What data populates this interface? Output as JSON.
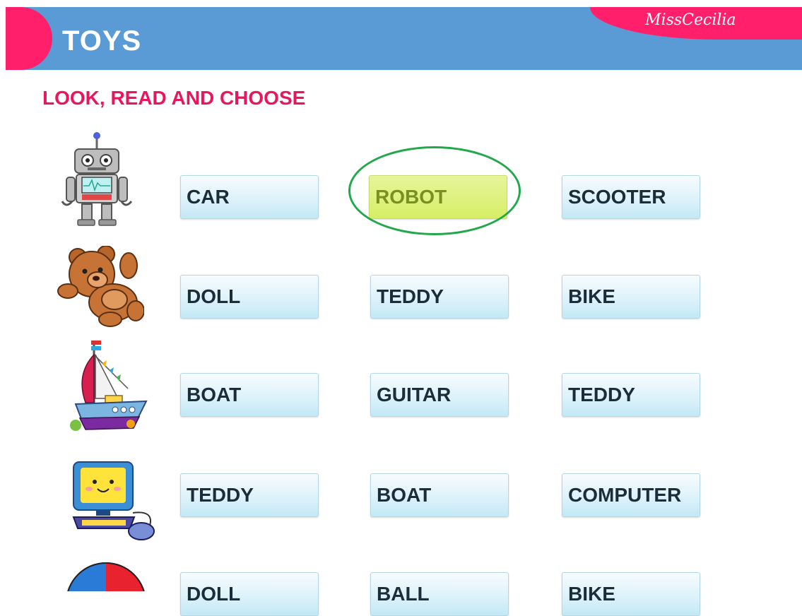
{
  "header": {
    "title": "TOYS",
    "brand": "MissCecilia"
  },
  "instruction": "LOOK, READ AND CHOOSE",
  "rows": [
    {
      "picture": "robot-icon",
      "options": [
        "CAR",
        "ROBOT",
        "SCOOTER"
      ],
      "selected": 1
    },
    {
      "picture": "teddy-icon",
      "options": [
        "DOLL",
        "TEDDY",
        "BIKE"
      ]
    },
    {
      "picture": "boat-icon",
      "options": [
        "BOAT",
        "GUITAR",
        "TEDDY"
      ]
    },
    {
      "picture": "computer-icon",
      "options": [
        "TEDDY",
        "BOAT",
        "COMPUTER"
      ]
    },
    {
      "picture": "ball-icon",
      "options": [
        "DOLL",
        "BALL",
        "BIKE"
      ]
    }
  ],
  "colors": {
    "header": "#5b9bd5",
    "accent": "#ff1f6b",
    "selected": "#d6ee66",
    "circle": "#22a84a"
  }
}
